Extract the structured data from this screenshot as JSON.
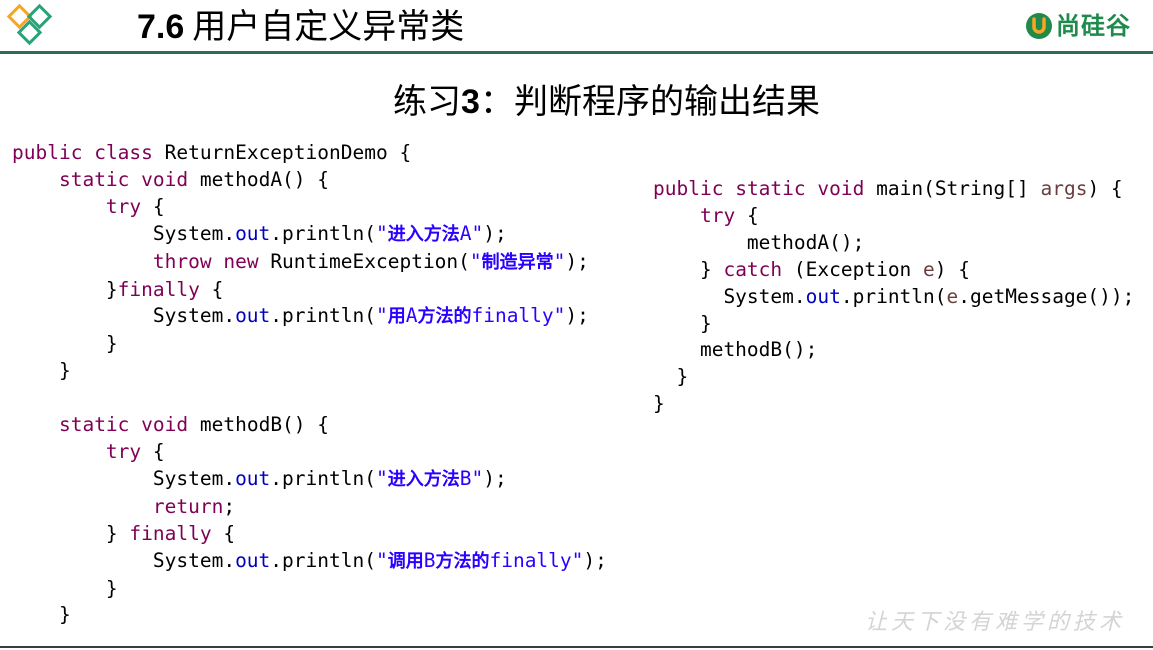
{
  "header": {
    "section_number": "7.6",
    "section_title": "用户自定义异常类",
    "brand_name": "尚硅谷",
    "accent_color": "#2f6b5a",
    "brand_color": "#1f8a4c",
    "logo_colors": [
      "#f5a623",
      "#27a37a"
    ]
  },
  "exercise": {
    "label_prefix": "练习",
    "number": "3",
    "separator": "：",
    "title": "判断程序的输出结果"
  },
  "code_left": {
    "class_header": "public class ReturnExceptionDemo {",
    "lines": [
      "    static void methodA() {",
      "        try {",
      "            System.out.println(\"进入方法A\");",
      "            throw new RuntimeException(\"制造异常\");",
      "        }finally {",
      "            System.out.println(\"用A方法的finally\");",
      "        }",
      "    }",
      "",
      "    static void methodB() {",
      "        try {",
      "            System.out.println(\"进入方法B\");",
      "            return;",
      "        } finally {",
      "            System.out.println(\"调用B方法的finally\");",
      "        }",
      "    }"
    ]
  },
  "code_right": {
    "lines": [
      "public static void main(String[] args) {",
      "    try {",
      "        methodA();",
      "    } catch (Exception e) {",
      "      System.out.println(e.getMessage());",
      "    }",
      "    methodB();",
      "  }",
      "}"
    ]
  },
  "footer": {
    "slogan": "让天下没有难学的技术"
  }
}
